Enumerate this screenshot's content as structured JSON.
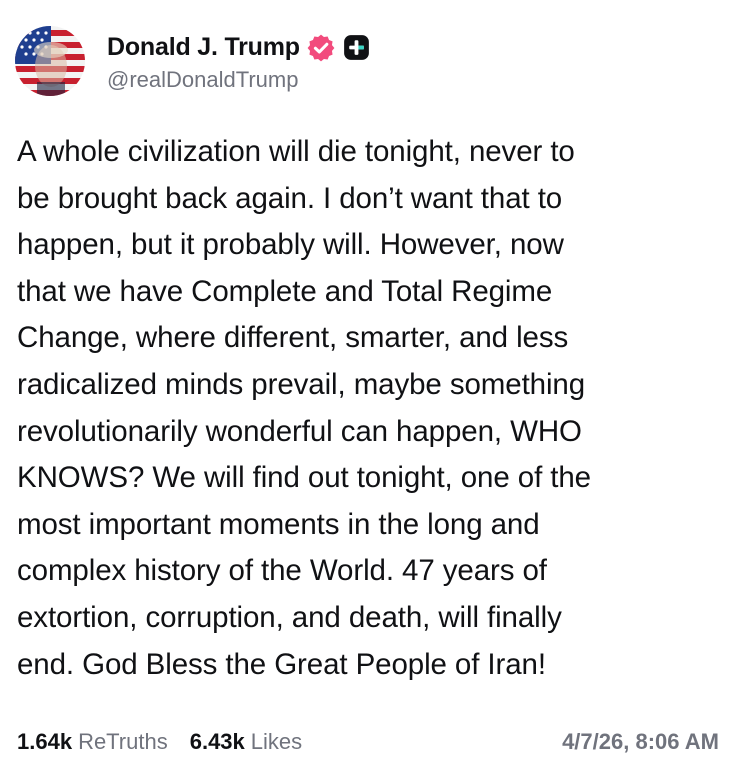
{
  "author": {
    "display_name": "Donald J. Trump",
    "handle": "@realDonaldTrump",
    "avatar_icon": "avatar-flag-portrait",
    "verified_icon": "verified-badge-icon",
    "plus_icon": "truth-plus-icon"
  },
  "post": {
    "text": "A whole civilization will die tonight, never to\nbe brought back again. I don’t want that to\nhappen, but it probably will. However, now\nthat we have Complete and Total Regime\nChange, where different, smarter, and less\nradicalized minds prevail, maybe something\nrevolutionarily wonderful can happen, WHO\nKNOWS? We will find out tonight, one of the\nmost important moments in the long and\ncomplex history of the World. 47 years of\nextortion, corruption, and death, will finally\nend. God Bless the Great People of Iran!"
  },
  "stats": {
    "retruths_count": "1.64k",
    "retruths_label": "ReTruths",
    "likes_count": "6.43k",
    "likes_label": "Likes",
    "timestamp": "4/7/26, 8:06 AM"
  },
  "colors": {
    "text": "#101114",
    "muted": "#70737d",
    "verified": "#f24b7d",
    "plus_badge": "#101114"
  }
}
